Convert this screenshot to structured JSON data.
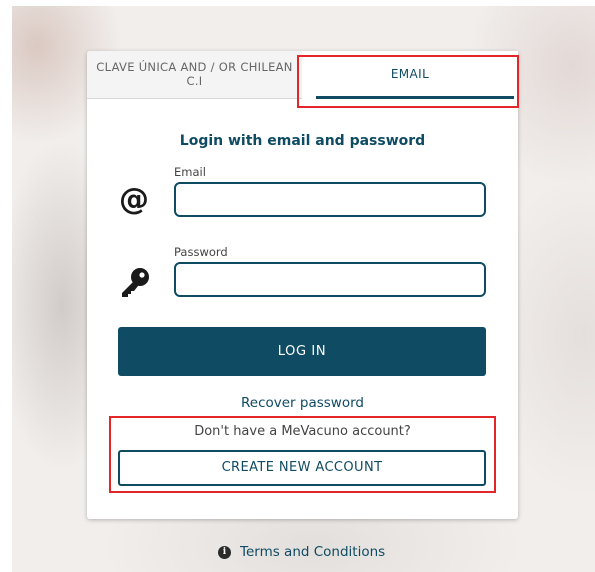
{
  "tabs": {
    "clave_line1": "CLAVE ÚNICA AND / OR CHILEAN",
    "clave_line2": "C.I",
    "email": "EMAIL"
  },
  "form": {
    "heading": "Login with email and password",
    "email_label": "Email",
    "password_label": "Password",
    "email_icon": "at-sign-icon",
    "password_icon": "key-icon"
  },
  "actions": {
    "login": "LOG IN",
    "recover": "Recover password",
    "no_account": "Don't have a MeVacuno account?",
    "create": "CREATE NEW ACCOUNT"
  },
  "footer": {
    "info_icon": "info-icon",
    "terms": "Terms and Conditions"
  },
  "colors": {
    "primary": "#0f4b63",
    "highlight": "#e3262a"
  }
}
